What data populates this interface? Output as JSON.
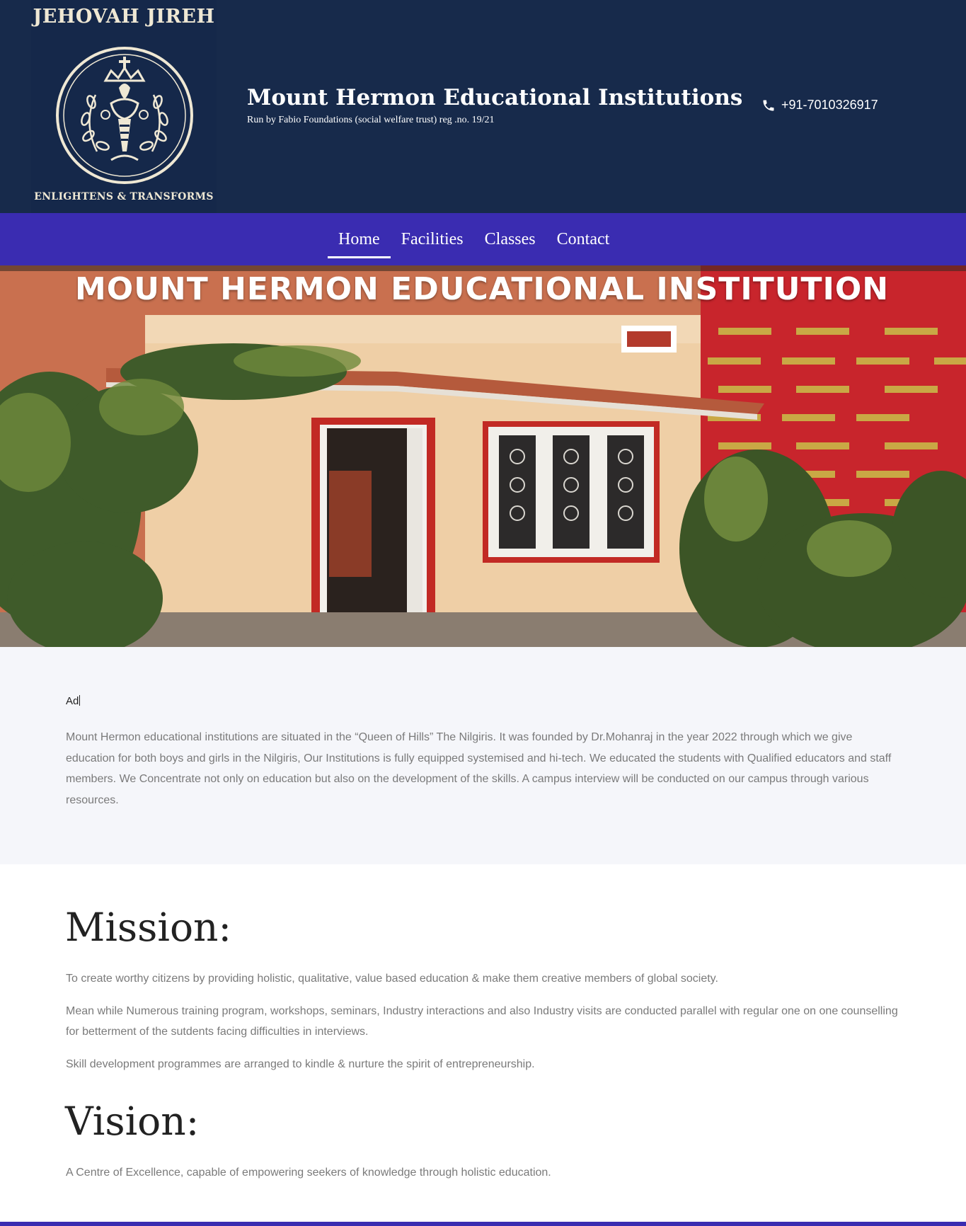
{
  "logo": {
    "top_text": "JEHOVAH JIREH",
    "bottom_text": "ENLIGHTENS & TRANSFORMS",
    "emblem_icon": "torch-wreath-emblem"
  },
  "header": {
    "title": "Mount Hermon Educational Institutions",
    "subtitle": "Run by Fabio Foundations (social welfare trust) reg .no. 19/21",
    "phone": "+91-7010326917",
    "phone_icon": "phone-icon",
    "bg_color": "#172a4b"
  },
  "nav": {
    "bg_color": "#3a2cb1",
    "items": [
      {
        "label": "Home",
        "active": true
      },
      {
        "label": "Facilities",
        "active": false
      },
      {
        "label": "Classes",
        "active": false
      },
      {
        "label": "Contact",
        "active": false
      }
    ]
  },
  "hero": {
    "sign_text": "MOUNT HERMON EDUCATIONAL INSTITUTION"
  },
  "about": {
    "ad_text": "Ad",
    "paragraph": "Mount Hermon educational institutions are situated in the “Queen of Hills” The Nilgiris. It was founded by Dr.Mohanraj in the year 2022 through which we give education for both boys and girls in the Nilgiris, Our Institutions is fully equipped systemised and hi-tech. We educated the students with Qualified educators and staff members. We Concentrate not only on education but also on the development of the skills. A campus interview will be conducted on our campus through various resources."
  },
  "mission": {
    "heading": "Mission:",
    "paragraphs": [
      "To create worthy citizens by providing holistic, qualitative, value based education & make them creative members of global society.",
      "Mean while Numerous training program, workshops, seminars, Industry interactions and also Industry visits are conducted parallel with regular one on one counselling for betterment of the sutdents facing difficulties in interviews.",
      "Skill development programmes are arranged to kindle & nurture the spirit of entrepreneurship."
    ]
  },
  "vision": {
    "heading": "Vision:",
    "paragraph": "A Centre of Excellence, capable of empowering seekers of knowledge through holistic education."
  }
}
